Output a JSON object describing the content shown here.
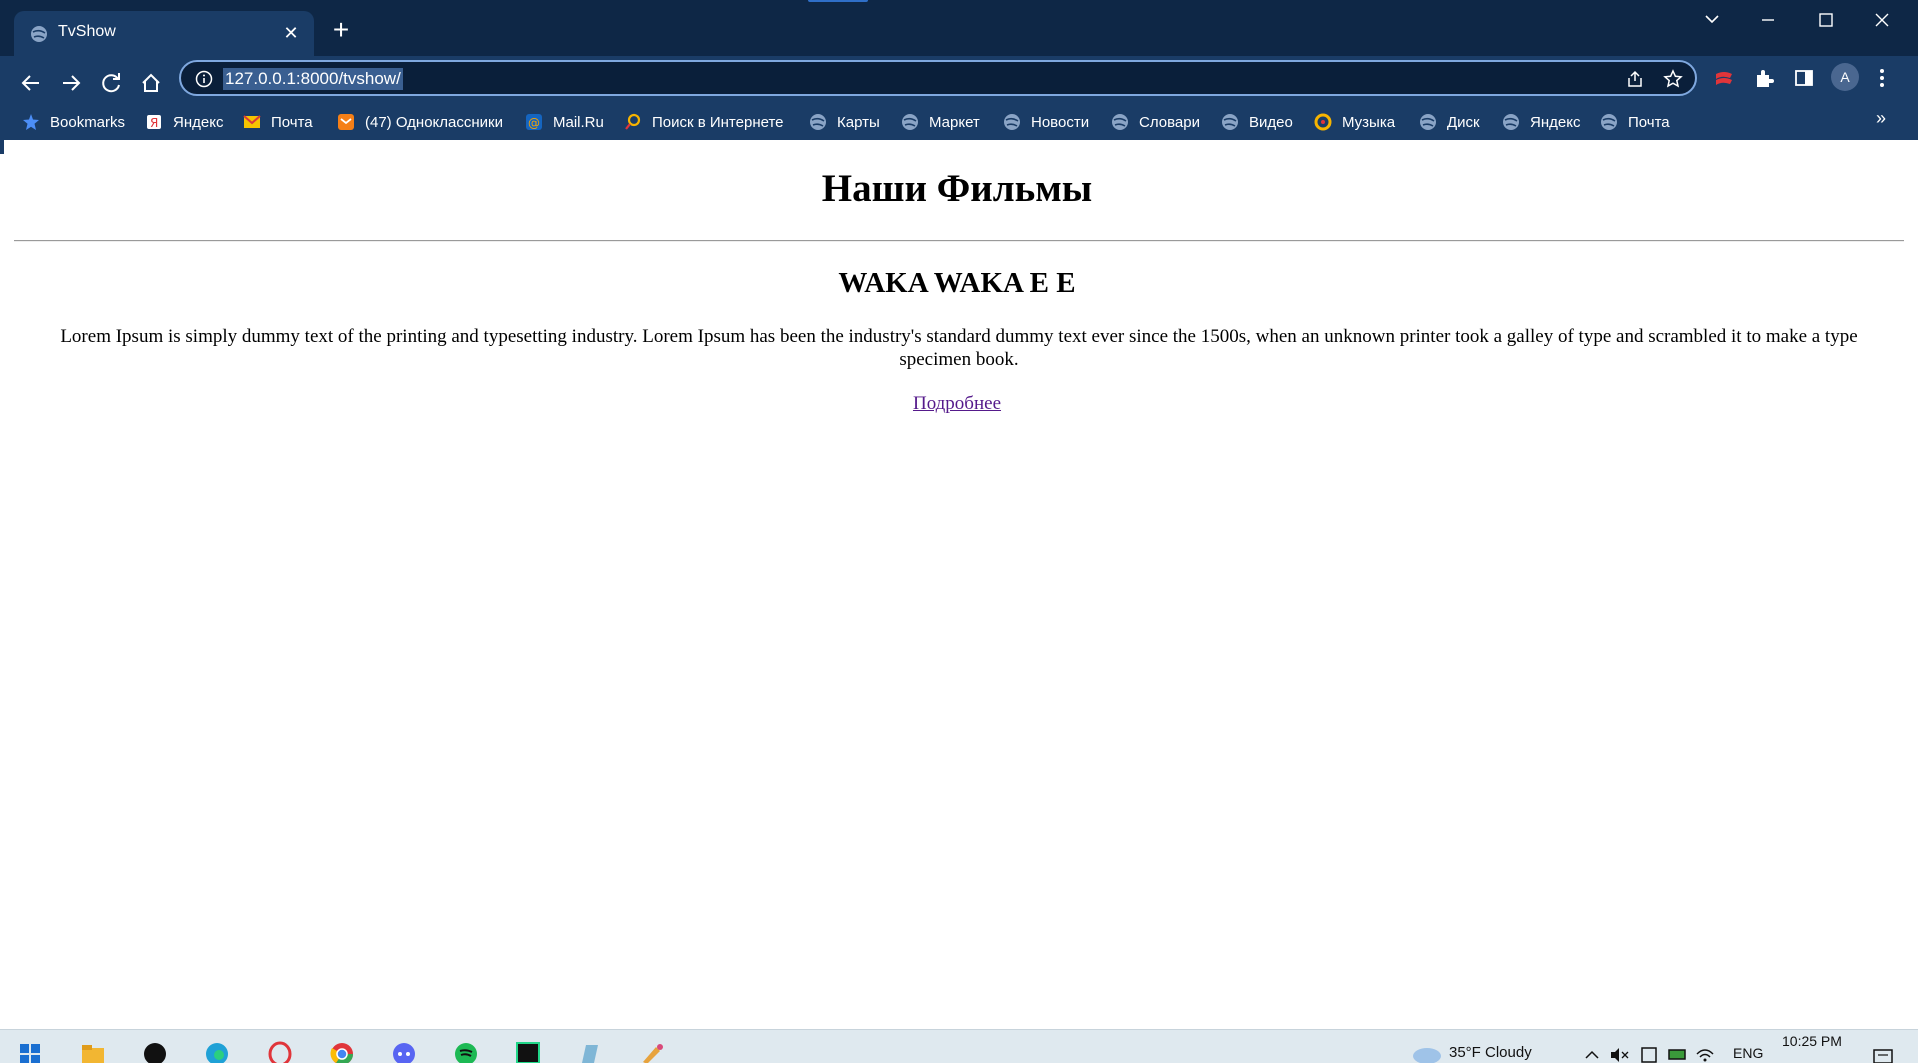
{
  "browser": {
    "tab_title": "TvShow",
    "tab_close": "✕",
    "new_tab": "+",
    "url": "127.0.0.1:8000/tvshow/",
    "profile_initial": "A",
    "bookmarks_overflow": "»",
    "bookmarks": [
      {
        "label": "Bookmarks",
        "icon": "star-icon"
      },
      {
        "label": "Яндекс",
        "icon": "yandex-icon"
      },
      {
        "label": "Почта",
        "icon": "mail-icon"
      },
      {
        "label": "(47) Одноклассники",
        "icon": "odnoklassniki-icon"
      },
      {
        "label": "Mail.Ru",
        "icon": "mailru-icon"
      },
      {
        "label": "Поиск в Интернете",
        "icon": "search-icon"
      },
      {
        "label": "Карты",
        "icon": "globe-icon"
      },
      {
        "label": "Маркет",
        "icon": "globe-icon"
      },
      {
        "label": "Новости",
        "icon": "globe-icon"
      },
      {
        "label": "Словари",
        "icon": "globe-icon"
      },
      {
        "label": "Видео",
        "icon": "globe-icon"
      },
      {
        "label": "Музыка",
        "icon": "music-icon"
      },
      {
        "label": "Диск",
        "icon": "globe-icon"
      },
      {
        "label": "Яндекс",
        "icon": "globe-icon"
      },
      {
        "label": "Почта",
        "icon": "globe-icon"
      }
    ]
  },
  "page": {
    "heading": "Наши Фильмы",
    "show_title": "WAKA WAKA E E",
    "description": "Lorem Ipsum is simply dummy text of the printing and typesetting industry. Lorem Ipsum has been the industry's standard dummy text ever since the 1500s, when an unknown printer took a galley of type and scrambled it to make a type specimen book.",
    "more_link": "Подробнее"
  },
  "taskbar": {
    "weather": "35°F  Cloudy",
    "language": "ENG",
    "time": "10:25 PM"
  },
  "colors": {
    "titlebar": "#0e2746",
    "toolbar": "#1a3c66",
    "link_visited": "#551a8b"
  }
}
